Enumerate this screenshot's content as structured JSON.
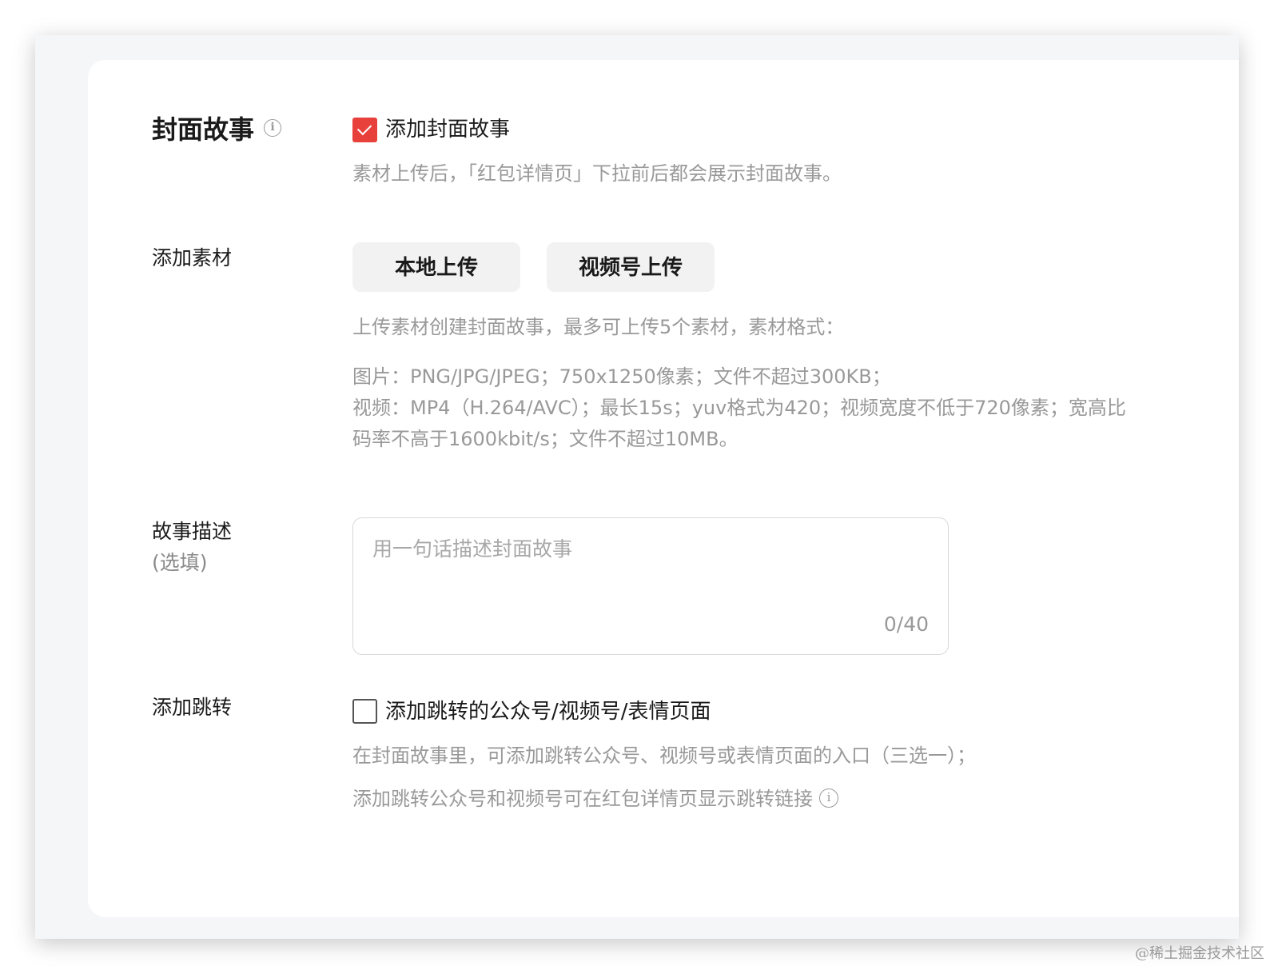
{
  "cover_story": {
    "label": "封面故事",
    "info_icon": "i",
    "checkbox_label": "添加封面故事",
    "checked": true,
    "hint": "素材上传后，「红包详情页」下拉前后都会展示封面故事。"
  },
  "add_material": {
    "label": "添加素材",
    "local_upload": "本地上传",
    "channel_upload": "视频号上传",
    "hint_intro": "上传素材创建封面故事，最多可上传5个素材，素材格式：",
    "hint_image": "图片：PNG/JPG/JPEG；750x1250像素；文件不超过300KB；",
    "hint_video": "视频：MP4（H.264/AVC）；最长15s；yuv格式为420；视频宽度不低于720像素；宽高比",
    "hint_bitrate": "码率不高于1600kbit/s；文件不超过10MB。"
  },
  "story_desc": {
    "label": "故事描述",
    "optional": "(选填)",
    "placeholder": "用一句话描述封面故事",
    "counter": "0/40"
  },
  "add_jump": {
    "label": "添加跳转",
    "checkbox_label": "添加跳转的公众号/视频号/表情页面",
    "checked": false,
    "hint_1": "在封面故事里，可添加跳转公众号、视频号或表情页面的入口（三选一）；",
    "hint_2": "添加跳转公众号和视频号可在红包详情页显示跳转链接",
    "info_icon": "i"
  },
  "watermark": "@稀土掘金技术社区",
  "colors": {
    "accent": "#e8413c",
    "hint": "#999999",
    "button_bg": "#f2f2f2"
  }
}
